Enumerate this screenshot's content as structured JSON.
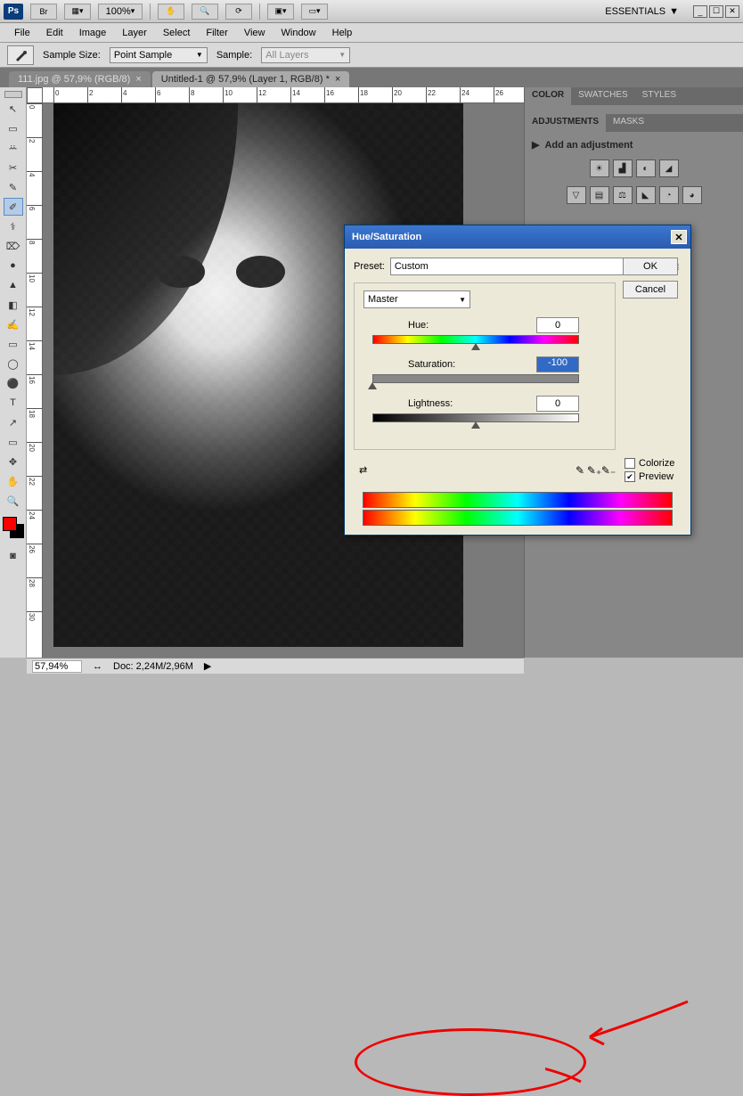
{
  "app": {
    "logo": "Ps"
  },
  "top_bar": {
    "zoom_display": "100%",
    "workspace_label": "ESSENTIALS"
  },
  "menu": [
    "File",
    "Edit",
    "Image",
    "Layer",
    "Select",
    "Filter",
    "View",
    "Window",
    "Help"
  ],
  "options": {
    "sample_size_label": "Sample Size:",
    "sample_size_value": "Point Sample",
    "sample_label": "Sample:",
    "sample_value": "All Layers"
  },
  "tabs": [
    {
      "label": "111.jpg @ 57,9% (RGB/8)",
      "active": false
    },
    {
      "label": "Untitled-1 @ 57,9% (Layer 1, RGB/8) *",
      "active": true
    }
  ],
  "tools": [
    "↖",
    "▭",
    "ꕁ",
    "✂",
    "✎",
    "✐",
    "⚕",
    "⌦",
    "●",
    "▲",
    "◧",
    "✍",
    "▭",
    "◯",
    "⚫",
    "✎",
    "T",
    "↗",
    "✥",
    "✋",
    "🔍"
  ],
  "colors": {
    "fg": "#ff0000",
    "bg": "#000000"
  },
  "panel_color": {
    "tabs": [
      "COLOR",
      "SWATCHES",
      "STYLES"
    ],
    "active": 0
  },
  "panel_adjust": {
    "tabs": [
      "ADJUSTMENTS",
      "MASKS"
    ],
    "active": 0,
    "title": "Add an adjustment",
    "row1": [
      "☀",
      "▟",
      "◐",
      "◢"
    ],
    "row2": [
      "▽",
      "▤",
      "⚖",
      "◣",
      "◔",
      "◕"
    ]
  },
  "dialog": {
    "title": "Hue/Saturation",
    "preset_label": "Preset:",
    "preset_value": "Custom",
    "ok": "OK",
    "cancel": "Cancel",
    "channel": "Master",
    "hue_label": "Hue:",
    "hue_value": "0",
    "sat_label": "Saturation:",
    "sat_value": "-100",
    "light_label": "Lightness:",
    "light_value": "0",
    "colorize_label": "Colorize",
    "colorize_checked": false,
    "preview_label": "Preview",
    "preview_checked": true
  },
  "status": {
    "zoom": "57,94%",
    "doc": "Doc: 2,24M/2,96M"
  },
  "ruler_h": [
    "0",
    "2",
    "4",
    "6",
    "8",
    "10",
    "12",
    "14",
    "16",
    "18",
    "20",
    "22",
    "24",
    "26"
  ],
  "ruler_v": [
    "0",
    "2",
    "4",
    "6",
    "8",
    "10",
    "12",
    "14",
    "16",
    "18",
    "20",
    "22",
    "24",
    "26",
    "28",
    "30"
  ]
}
